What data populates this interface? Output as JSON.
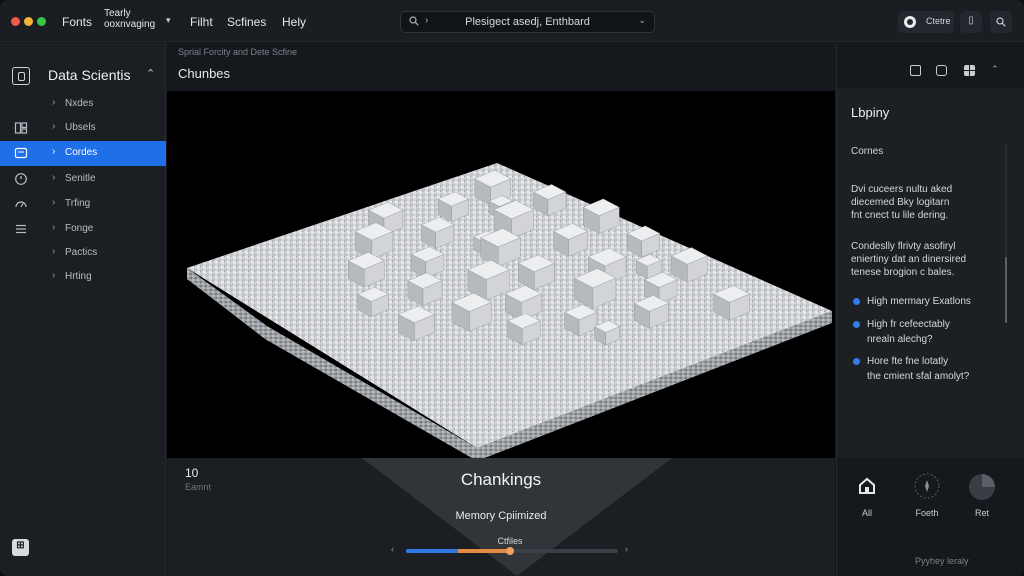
{
  "titlebar": {
    "menu": [
      "Fonts",
      "Filht",
      "Scfines",
      "Hely"
    ],
    "menu_stack": [
      "Tearly",
      "ooxnvaging"
    ],
    "search_text": "Plesigect asedj, Enthbard",
    "user_label": "Ctetre"
  },
  "sidebar": {
    "title": "Data Scientis",
    "items": [
      {
        "label": "Nxdes",
        "icon": "none"
      },
      {
        "label": "Ubsels",
        "icon": "layers-icon"
      },
      {
        "label": "Cordes",
        "icon": "code-icon",
        "active": true
      },
      {
        "label": "Senitle",
        "icon": "clock-icon"
      },
      {
        "label": "Trfing",
        "icon": "gauge-icon"
      },
      {
        "label": "Fonge",
        "icon": "none"
      },
      {
        "label": "Pactics",
        "icon": "none"
      },
      {
        "label": "Hrting",
        "icon": "none"
      }
    ],
    "footer_icon": "grid-icon"
  },
  "main": {
    "breadcrumb": "Sprial Forcity and Dete Scfine",
    "title": "Chunbes",
    "stat_value": "10",
    "stat_label": "Eamnt",
    "chunk_title": "Chankings",
    "chunk_subtitle": "Memory Cpiimized",
    "slider_label": "Ctfiles",
    "slider_level": 0.5
  },
  "rightpanel": {
    "title": "Lbpiny",
    "section": "Cornes",
    "para1": [
      "Dvi cuceers nultu aked",
      "diecemed Bky logitarn",
      "fnt cnect tu lile dering."
    ],
    "para2": [
      "Condeslly flrivty asofiryl",
      "eniertiny dat an dinersired",
      "tenese brogion c bales."
    ],
    "bullets": [
      [
        "High mermary Exatlons"
      ],
      [
        "High fr cefeectably",
        "nrealn alechg?"
      ],
      [
        "Hore fte fne lotatly",
        "the cmient sfal amolyt?"
      ]
    ],
    "buttons": [
      "All",
      "Foeth",
      "Ret"
    ],
    "footer": "Pyyhey leraly"
  },
  "colors": {
    "accent": "#1f6fe8",
    "slider_blue": "#2f7ae5",
    "slider_orange": "#e38a45"
  }
}
